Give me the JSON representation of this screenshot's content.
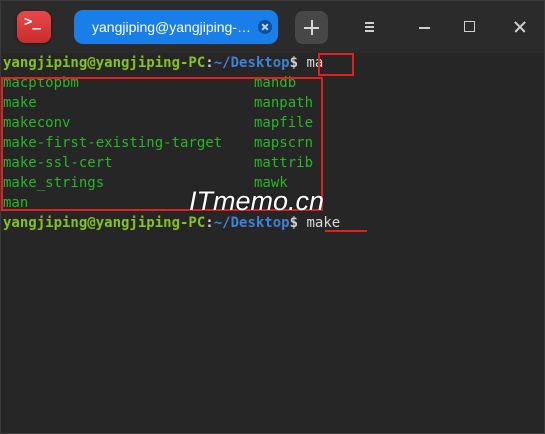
{
  "app": {
    "icon_name": "terminal-app-icon",
    "icon_glyph": ">_"
  },
  "tab": {
    "title": "yangjiping@yangjiping-…",
    "close_icon": "close-icon"
  },
  "toolbar": {
    "new_tab_icon": "plus-icon",
    "menu_icon": "hamburger-menu-icon",
    "minimize_icon": "minimize-icon",
    "maximize_icon": "maximize-icon",
    "close_icon": "close-icon"
  },
  "prompt": {
    "user_host": "yangjiping@yangjiping-PC",
    "colon": ":",
    "path": "~/Desktop",
    "dollar": "$"
  },
  "terminal": {
    "first_command": "ma",
    "completions_left": [
      "macptopbm",
      "make",
      "makeconv",
      "make-first-existing-target",
      "make-ssl-cert",
      "make_strings",
      "man"
    ],
    "completions_right": [
      "mandb",
      "manpath",
      "mapfile",
      "mapscrn",
      "mattrib",
      "mawk"
    ],
    "second_command": "make"
  },
  "watermark": "ITmemo.cn",
  "colors": {
    "accent_tab": "#1a7ee8",
    "prompt_user": "#85c31c",
    "prompt_path": "#3e80d8",
    "completion_text": "#27b627",
    "annotation_red": "#e32020",
    "background": "#262626"
  }
}
